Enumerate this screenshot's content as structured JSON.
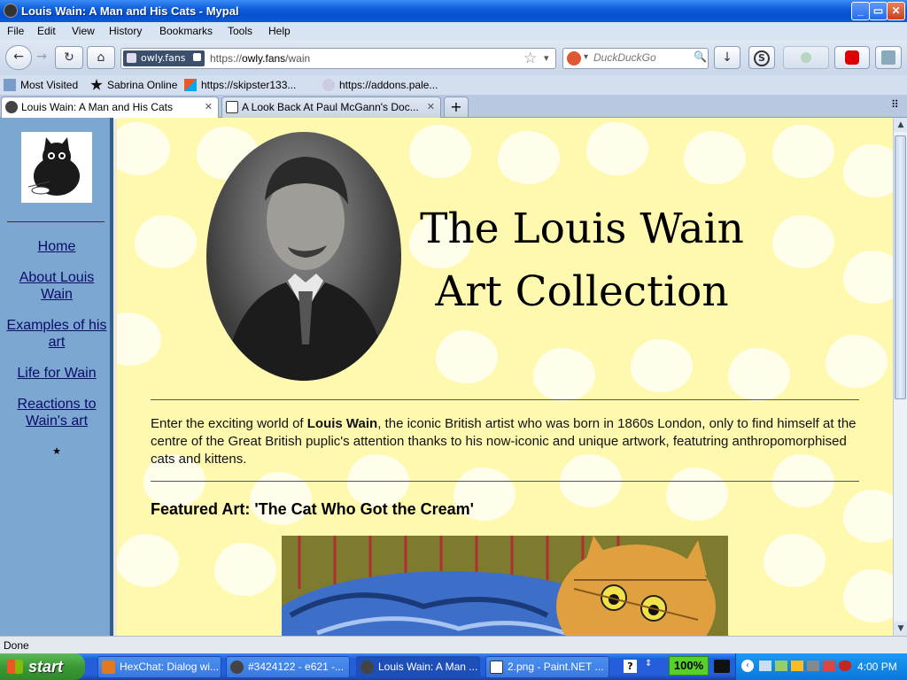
{
  "window": {
    "title": "Louis Wain: A Man and His Cats - Mypal",
    "minimize": "_",
    "restore": "▭",
    "close": "✕"
  },
  "menu": [
    "File",
    "Edit",
    "View",
    "History",
    "Bookmarks",
    "Tools",
    "Help"
  ],
  "nav": {
    "back": "←",
    "forward": "→",
    "reload": "↻",
    "home": "⌂",
    "site_identity": "owly.fans",
    "url_prefix": "https://",
    "url_host": "owly.fans",
    "url_path": "/wain",
    "bookmark_star": "☆",
    "dropdown": "▾",
    "search_placeholder": "DuckDuckGo",
    "search_glass": "🔍",
    "download": "↓",
    "addon_s": "S"
  },
  "bookmarks": [
    {
      "label": "Most Visited"
    },
    {
      "label": "Sabrina Online"
    },
    {
      "label": "https://skipster133..."
    },
    {
      "label": "https://addons.pale..."
    }
  ],
  "tabs": [
    {
      "label": "Louis Wain: A Man and His Cats",
      "close": "✕",
      "active": true
    },
    {
      "label": "A Look Back At Paul McGann's Doc...",
      "close": "✕",
      "active": false
    }
  ],
  "new_tab": "+",
  "tab_list": "⠿",
  "sidebar": {
    "links": [
      {
        "label": "Home"
      },
      {
        "label": "About Louis Wain"
      },
      {
        "label": "Examples of his art"
      },
      {
        "label": "Life for Wain"
      },
      {
        "label": "Reactions to Wain's art"
      }
    ],
    "star": "★"
  },
  "page": {
    "title_line1": "The Louis Wain",
    "title_line2": "Art Collection",
    "intro_before": "Enter the exciting world of ",
    "intro_bold": "Louis Wain",
    "intro_after": ", the iconic British artist who was born in 1860s London, only to find himself at the centre of the Great British puplic's attention thanks to his now-iconic and unique artwork, featutring anthropomorphised cats and kittens.",
    "featured_heading": "Featured Art: 'The Cat Who Got the Cream'"
  },
  "status": "Done",
  "taskbar": {
    "start": "start",
    "tasks": [
      {
        "label": "HexChat: Dialog wi..."
      },
      {
        "label": "#3424122 - e621 -..."
      },
      {
        "label": "Louis Wain: A Man ..."
      },
      {
        "label": "2.png - Paint.NET ..."
      }
    ],
    "help": "?",
    "zoom": "100%",
    "clock": "4:00 PM"
  },
  "colors": {
    "sidebar_bg": "#7ba7d0",
    "page_bg": "#fff9b0",
    "link": "#0b0b6a",
    "titlebar": "#0a5bd8"
  }
}
